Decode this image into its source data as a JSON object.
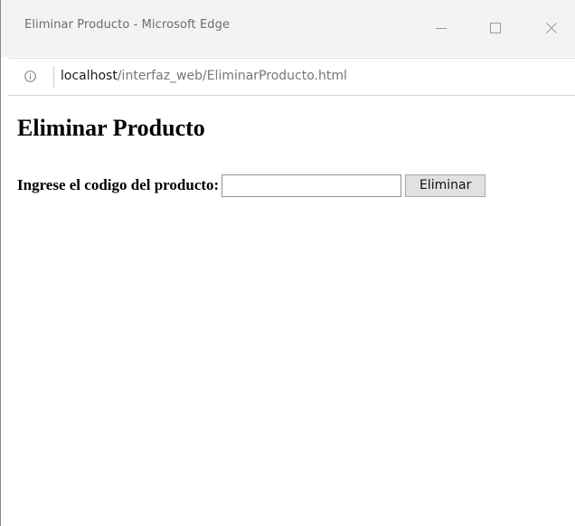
{
  "window": {
    "title": "Eliminar Producto - Microsoft Edge",
    "controls": {
      "minimize_icon": "minimize-icon",
      "maximize_icon": "maximize-icon",
      "close_icon": "close-icon"
    }
  },
  "address_bar": {
    "info_icon": "info-icon",
    "url_host": "localhost",
    "url_path": "/interfaz_web/EliminarProducto.html"
  },
  "page": {
    "heading": "Eliminar Producto",
    "form": {
      "label": "Ingrese el codigo del producto:",
      "code_value": "",
      "submit_label": "Eliminar"
    }
  },
  "colors": {
    "titlebar_bg": "#f3f3f3",
    "title_text": "#6d6d6d",
    "button_bg": "#e1e1e1"
  }
}
